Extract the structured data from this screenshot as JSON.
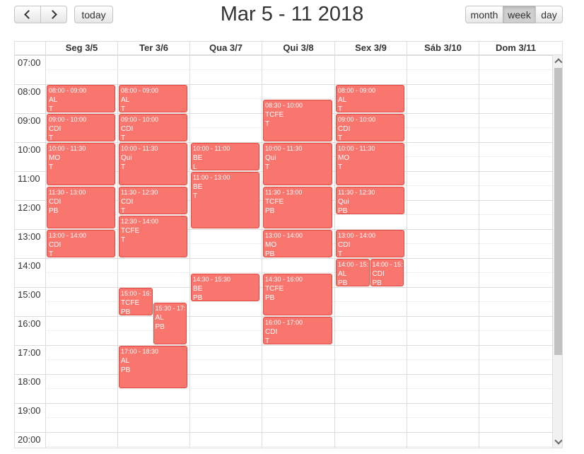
{
  "toolbar": {
    "prev_icon": "chevron-left-icon",
    "next_icon": "chevron-right-icon",
    "today_label": "today",
    "title": "Mar 5 - 11 2018",
    "views": [
      "month",
      "week",
      "day"
    ],
    "active_view": "week"
  },
  "days": [
    "Seg 3/5",
    "Ter 3/6",
    "Qua 3/7",
    "Qui 3/8",
    "Sex 3/9",
    "Sáb 3/10",
    "Dom 3/11"
  ],
  "hours": [
    "07:00",
    "08:00",
    "09:00",
    "10:00",
    "11:00",
    "12:00",
    "13:00",
    "14:00",
    "15:00",
    "16:00",
    "17:00",
    "18:00",
    "19:00",
    "20:00"
  ],
  "event_color": "#f8766d",
  "events": [
    {
      "day": 0,
      "time": "08:00 - 09:00",
      "subject": "AL",
      "room": "T"
    },
    {
      "day": 0,
      "time": "09:00 - 10:00",
      "subject": "CDI",
      "room": "T"
    },
    {
      "day": 0,
      "time": "10:00 - 11:30",
      "subject": "MO",
      "room": "T"
    },
    {
      "day": 0,
      "time": "11:30 - 13:00",
      "subject": "CDI",
      "room": "PB"
    },
    {
      "day": 0,
      "time": "13:00 - 14:00",
      "subject": "CDI",
      "room": "T"
    },
    {
      "day": 1,
      "time": "08:00 - 09:00",
      "subject": "AL",
      "room": "T"
    },
    {
      "day": 1,
      "time": "09:00 - 10:00",
      "subject": "CDI",
      "room": "T"
    },
    {
      "day": 1,
      "time": "10:00 - 11:30",
      "subject": "Qui",
      "room": "T"
    },
    {
      "day": 1,
      "time": "11:30 - 12:30",
      "subject": "CDI",
      "room": "T"
    },
    {
      "day": 1,
      "time": "12:30 - 14:00",
      "subject": "TCFE",
      "room": "T"
    },
    {
      "day": 1,
      "time": "15:00 - 16:",
      "subject": "TCFE",
      "room": "PB",
      "col": 0,
      "cols": 2
    },
    {
      "day": 1,
      "time": "15:30 - 17:",
      "subject": "AL",
      "room": "PB",
      "col": 1,
      "cols": 2
    },
    {
      "day": 1,
      "time": "17:00 - 18:30",
      "subject": "AL",
      "room": "PB"
    },
    {
      "day": 2,
      "time": "10:00 - 11:00",
      "subject": "BE",
      "room": "L"
    },
    {
      "day": 2,
      "time": "11:00 - 13:00",
      "subject": "BE",
      "room": "T"
    },
    {
      "day": 2,
      "time": "14:30 - 15:30",
      "subject": "BE",
      "room": "PB"
    },
    {
      "day": 3,
      "time": "08:30 - 10:00",
      "subject": "TCFE",
      "room": "T"
    },
    {
      "day": 3,
      "time": "10:00 - 11:30",
      "subject": "Qui",
      "room": "T"
    },
    {
      "day": 3,
      "time": "11:30 - 13:00",
      "subject": "TCFE",
      "room": "PB"
    },
    {
      "day": 3,
      "time": "13:00 - 14:00",
      "subject": "MO",
      "room": "PB"
    },
    {
      "day": 3,
      "time": "14:30 - 16:00",
      "subject": "TCFE",
      "room": "PB"
    },
    {
      "day": 3,
      "time": "16:00 - 17:00",
      "subject": "CDI",
      "room": "T"
    },
    {
      "day": 4,
      "time": "08:00 - 09:00",
      "subject": "AL",
      "room": "T"
    },
    {
      "day": 4,
      "time": "09:00 - 10:00",
      "subject": "CDI",
      "room": "T"
    },
    {
      "day": 4,
      "time": "10:00 - 11:30",
      "subject": "MO",
      "room": "T"
    },
    {
      "day": 4,
      "time": "11:30 - 12:30",
      "subject": "Qui",
      "room": "PB"
    },
    {
      "day": 4,
      "time": "13:00 - 14:00",
      "subject": "CDI",
      "room": "T"
    },
    {
      "day": 4,
      "time": "14:00 - 15:",
      "subject": "AL",
      "room": "PB",
      "col": 0,
      "cols": 2
    },
    {
      "day": 4,
      "time": "14:00 - 15:",
      "subject": "CDI",
      "room": "PB",
      "col": 1,
      "cols": 2
    }
  ]
}
